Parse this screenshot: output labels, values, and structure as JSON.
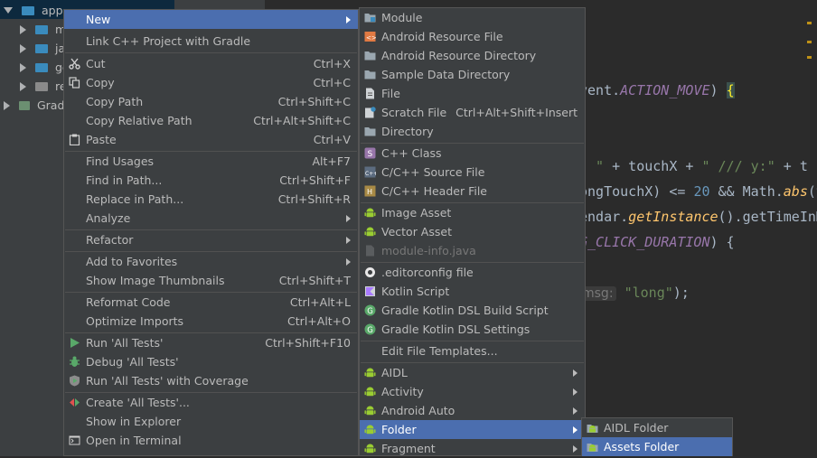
{
  "tree": {
    "items": [
      {
        "label": "app"
      },
      {
        "label": "m"
      },
      {
        "label": "jav"
      },
      {
        "label": "ge"
      },
      {
        "label": "re"
      },
      {
        "label": "Gradl"
      }
    ]
  },
  "editor": {
    "lines": [
      {
        "plain": "vent.",
        "italic": "ACTION_MOVE",
        "tail": ") ",
        "brace": "{"
      },
      {
        "str1": ": \"",
        "mid": " + touchX + ",
        "str2": "\" /// y:\"",
        "tail2": " + t"
      },
      {
        "a": "ongTouchX) <= ",
        "num": "20",
        "b": " && Math.",
        "fn": "abs",
        "c": "(t"
      },
      {
        "a": "endar.",
        "fn": "getInstance",
        "b": "().getTimeInMi"
      },
      {
        "it": "G_CLICK_DURATION",
        "tail": ") {"
      },
      {
        "hint": "msg:",
        "str": "\"long\"",
        "tail": ");"
      }
    ]
  },
  "context_menu": {
    "items": [
      {
        "label": "New",
        "shortcut": ""
      },
      {
        "label": "Link C++ Project with Gradle",
        "shortcut": ""
      },
      {
        "label": "Cut",
        "shortcut": "Ctrl+X"
      },
      {
        "label": "Copy",
        "shortcut": "Ctrl+C"
      },
      {
        "label": "Copy Path",
        "shortcut": "Ctrl+Shift+C"
      },
      {
        "label": "Copy Relative Path",
        "shortcut": "Ctrl+Alt+Shift+C"
      },
      {
        "label": "Paste",
        "shortcut": "Ctrl+V"
      },
      {
        "label": "Find Usages",
        "shortcut": "Alt+F7"
      },
      {
        "label": "Find in Path...",
        "shortcut": "Ctrl+Shift+F"
      },
      {
        "label": "Replace in Path...",
        "shortcut": "Ctrl+Shift+R"
      },
      {
        "label": "Analyze",
        "shortcut": ""
      },
      {
        "label": "Refactor",
        "shortcut": ""
      },
      {
        "label": "Add to Favorites",
        "shortcut": ""
      },
      {
        "label": "Show Image Thumbnails",
        "shortcut": "Ctrl+Shift+T"
      },
      {
        "label": "Reformat Code",
        "shortcut": "Ctrl+Alt+L"
      },
      {
        "label": "Optimize Imports",
        "shortcut": "Ctrl+Alt+O"
      },
      {
        "label": "Run 'All Tests'",
        "shortcut": "Ctrl+Shift+F10"
      },
      {
        "label": "Debug 'All Tests'",
        "shortcut": ""
      },
      {
        "label": "Run 'All Tests' with Coverage",
        "shortcut": ""
      },
      {
        "label": "Create 'All Tests'...",
        "shortcut": ""
      },
      {
        "label": "Show in Explorer",
        "shortcut": ""
      },
      {
        "label": "Open in Terminal",
        "shortcut": ""
      }
    ]
  },
  "new_menu": {
    "items": [
      {
        "label": "Module",
        "shortcut": ""
      },
      {
        "label": "Android Resource File",
        "shortcut": ""
      },
      {
        "label": "Android Resource Directory",
        "shortcut": ""
      },
      {
        "label": "Sample Data Directory",
        "shortcut": ""
      },
      {
        "label": "File",
        "shortcut": ""
      },
      {
        "label": "Scratch File",
        "shortcut": "Ctrl+Alt+Shift+Insert"
      },
      {
        "label": "Directory",
        "shortcut": ""
      },
      {
        "label": "C++ Class",
        "shortcut": ""
      },
      {
        "label": "C/C++ Source File",
        "shortcut": ""
      },
      {
        "label": "C/C++ Header File",
        "shortcut": ""
      },
      {
        "label": "Image Asset",
        "shortcut": ""
      },
      {
        "label": "Vector Asset",
        "shortcut": ""
      },
      {
        "label": "module-info.java",
        "shortcut": ""
      },
      {
        "label": ".editorconfig file",
        "shortcut": ""
      },
      {
        "label": "Kotlin Script",
        "shortcut": ""
      },
      {
        "label": "Gradle Kotlin DSL Build Script",
        "shortcut": ""
      },
      {
        "label": "Gradle Kotlin DSL Settings",
        "shortcut": ""
      },
      {
        "label": "Edit File Templates...",
        "shortcut": ""
      },
      {
        "label": "AIDL",
        "shortcut": ""
      },
      {
        "label": "Activity",
        "shortcut": ""
      },
      {
        "label": "Android Auto",
        "shortcut": ""
      },
      {
        "label": "Folder",
        "shortcut": ""
      },
      {
        "label": "Fragment",
        "shortcut": ""
      }
    ]
  },
  "folder_menu": {
    "items": [
      {
        "label": "AIDL Folder"
      },
      {
        "label": "Assets Folder"
      }
    ]
  },
  "colors": {
    "menu_bg": "#3c3f41",
    "selection": "#4b6eaf",
    "android_green": "#9acd32"
  }
}
